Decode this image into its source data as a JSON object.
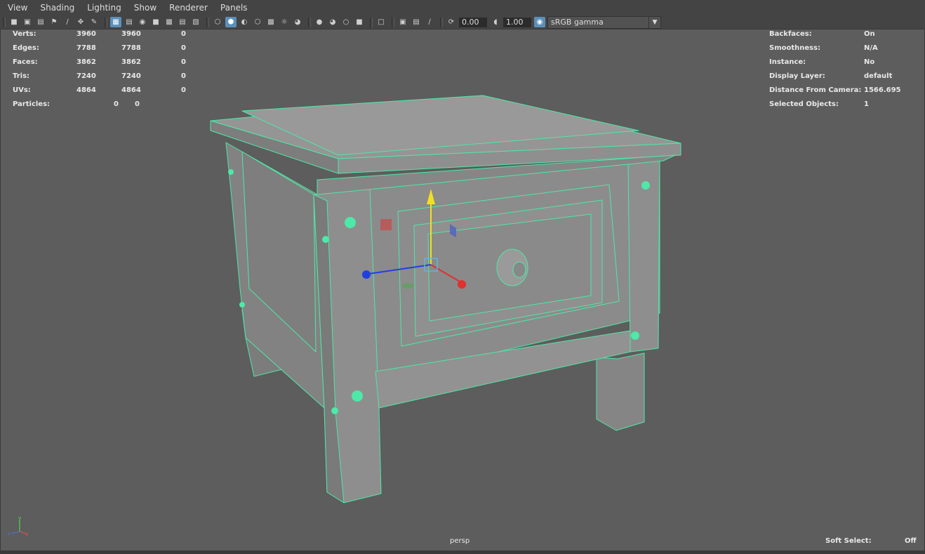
{
  "menu": {
    "items": [
      "View",
      "Shading",
      "Lighting",
      "Show",
      "Renderer",
      "Panels"
    ]
  },
  "toolbar": {
    "exposure_value": "0.00",
    "gamma_value": "1.00",
    "color_space": "sRGB gamma"
  },
  "hud_left": {
    "rows": [
      {
        "label": "Verts:",
        "a": "3960",
        "b": "3960",
        "c": "0"
      },
      {
        "label": "Edges:",
        "a": "7788",
        "b": "7788",
        "c": "0"
      },
      {
        "label": "Faces:",
        "a": "3862",
        "b": "3862",
        "c": "0"
      },
      {
        "label": "Tris:",
        "a": "7240",
        "b": "7240",
        "c": "0"
      },
      {
        "label": "UVs:",
        "a": "4864",
        "b": "4864",
        "c": "0"
      }
    ],
    "particles": {
      "label": "Particles:",
      "a": "0",
      "b": "0"
    }
  },
  "hud_right": {
    "rows": [
      {
        "label": "Backfaces:",
        "value": "On"
      },
      {
        "label": "Smoothness:",
        "value": "N/A"
      },
      {
        "label": "Instance:",
        "value": "No"
      },
      {
        "label": "Display Layer:",
        "value": "default"
      },
      {
        "label": "Distance From Camera:",
        "value": "1566.695"
      },
      {
        "label": "Selected Objects:",
        "value": "1"
      }
    ]
  },
  "viewport": {
    "camera_name": "persp",
    "soft_select_label": "Soft Select:",
    "soft_select_value": "Off"
  },
  "colors": {
    "background": "#5d5d5d",
    "wireframe": "#4ee8a8",
    "face": "#8a8a8a",
    "accent": "#5b8fb9"
  }
}
